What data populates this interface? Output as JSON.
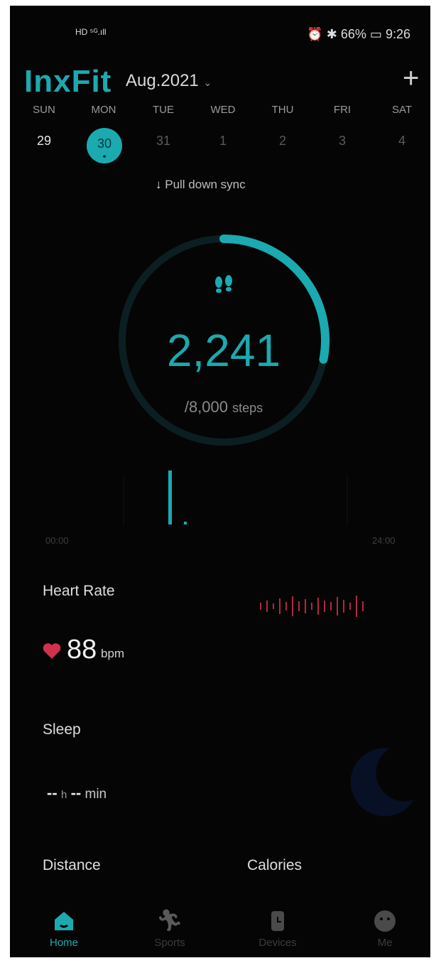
{
  "status_bar": {
    "left": "HD ⁵ᴳ.ıll",
    "battery_percent": "66%",
    "time": "9:26"
  },
  "header": {
    "app_name": "InxFit",
    "month": "Aug.2021"
  },
  "week": {
    "day_names": [
      "SUN",
      "MON",
      "TUE",
      "WED",
      "THU",
      "FRI",
      "SAT"
    ],
    "dates": [
      "29",
      "30",
      "31",
      "1",
      "2",
      "3",
      "4"
    ],
    "selected": "30"
  },
  "sync_hint": "Pull down sync",
  "steps": {
    "value": "2,241",
    "goal": "/8,000",
    "unit": "steps",
    "progress": 0.28
  },
  "timeline": {
    "start": "00:00",
    "end": "24:00"
  },
  "heart_rate": {
    "title": "Heart Rate",
    "value": "88",
    "unit": "bpm"
  },
  "sleep": {
    "title": "Sleep",
    "hours": "--",
    "hours_unit": "h",
    "minutes": "--",
    "minutes_unit": "min"
  },
  "distance": {
    "title": "Distance"
  },
  "calories": {
    "title": "Calories"
  },
  "nav": {
    "home": "Home",
    "sports": "Sports",
    "devices": "Devices",
    "me": "Me"
  },
  "colors": {
    "accent": "#1aaab0",
    "heart": "#d2314d",
    "background": "#050505"
  }
}
